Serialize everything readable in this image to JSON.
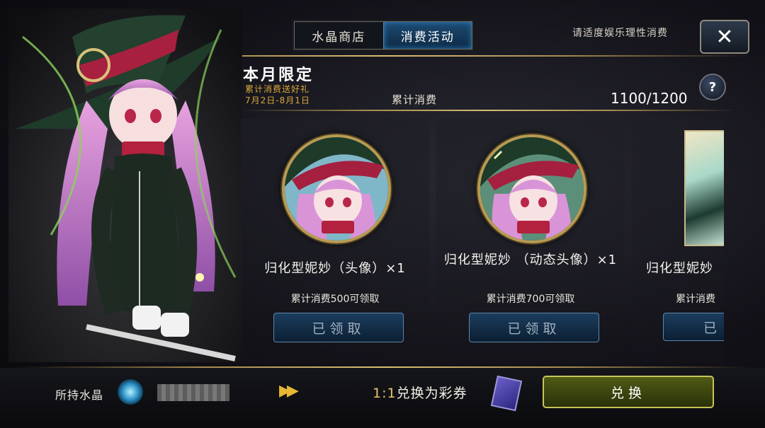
{
  "tabs": [
    {
      "label": "水晶商店",
      "active": false
    },
    {
      "label": "消费活动",
      "active": true
    }
  ],
  "top_hint": "请适度娱乐理性消费",
  "close_label": "✕",
  "promo": {
    "title": "本月限定",
    "subtitle": "累计消费送好礼",
    "date_range": "7月2日-8月1日"
  },
  "progress": {
    "label": "累计消费",
    "value": "1100/1200",
    "current": 1100,
    "target": 1200
  },
  "help_label": "?",
  "rewards": [
    {
      "name": "归化型妮妙（头像）×1",
      "condition": "累计消费500可领取",
      "button": "已领取"
    },
    {
      "name": "归化型妮妙 （动态头像）×1",
      "condition": "累计消费700可领取",
      "button": "已领取"
    },
    {
      "name": "归化型妮妙",
      "condition": "累计消费",
      "button": "已"
    }
  ],
  "bottom": {
    "crystal_label": "所持水晶",
    "arrows": "▶▶",
    "ratio_num": "1:1",
    "ratio_text": "兑换为彩券",
    "exchange_button": "兑换"
  },
  "colors": {
    "gold": "#d9a93a",
    "tab_active": "#1d4b73",
    "claim_button": "#1b3d5d",
    "exchange_button": "#4f5a15"
  }
}
